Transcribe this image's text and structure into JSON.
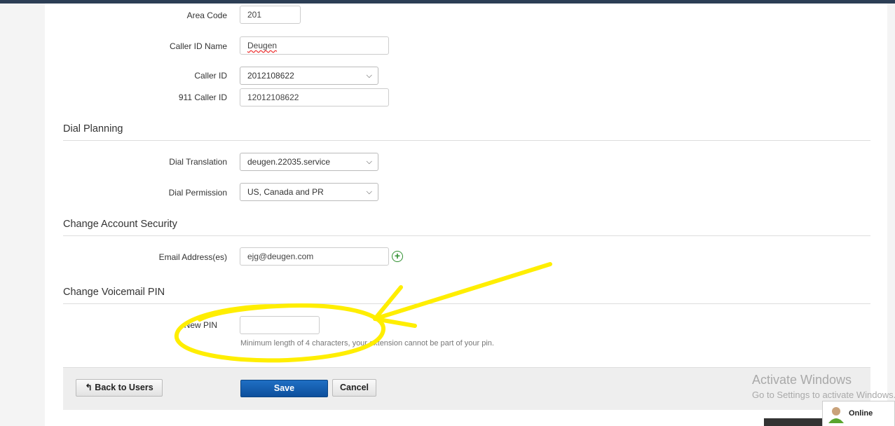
{
  "fields": {
    "area_code": {
      "label": "Area Code",
      "value": "201"
    },
    "caller_id_name": {
      "label": "Caller ID Name",
      "value": "Deugen"
    },
    "caller_id": {
      "label": "Caller ID",
      "value": "2012108622"
    },
    "caller_id_911": {
      "label": "911 Caller ID",
      "value": "12012108622"
    }
  },
  "dial_planning": {
    "title": "Dial Planning",
    "dial_translation": {
      "label": "Dial Translation",
      "value": "deugen.22035.service"
    },
    "dial_permission": {
      "label": "Dial Permission",
      "value": "US, Canada and PR"
    }
  },
  "account_security": {
    "title": "Change Account Security",
    "email": {
      "label": "Email Address(es)",
      "value": "ejg@deugen.com"
    }
  },
  "voicemail": {
    "title": "Change Voicemail PIN",
    "new_pin": {
      "label": "New PIN",
      "value": ""
    },
    "hint": "Minimum length of 4 characters, your extension cannot be part of your pin."
  },
  "footer": {
    "back_label": "Back to Users",
    "save_label": "Save",
    "cancel_label": "Cancel"
  },
  "watermark": {
    "title": "Activate Windows",
    "subtitle": "Go to Settings to activate Windows."
  },
  "chat": {
    "status": "Online"
  },
  "colors": {
    "annotation": "#ffee00",
    "primary": "#1160b5"
  }
}
